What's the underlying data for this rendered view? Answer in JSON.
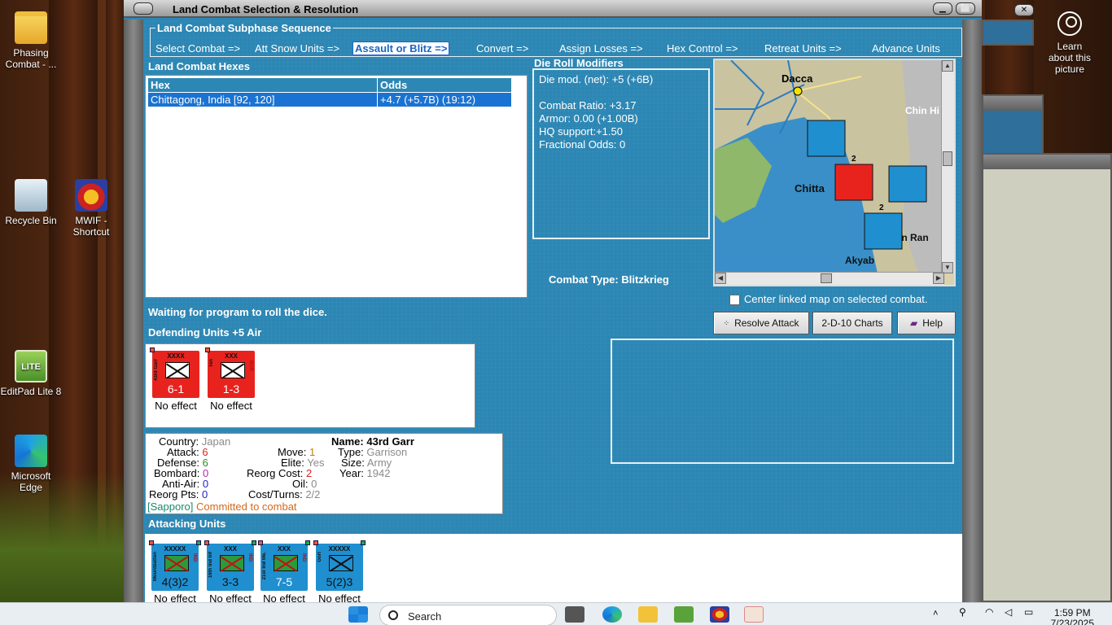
{
  "desktop": {
    "icons": [
      {
        "label": "Phasing Combat - ..."
      },
      {
        "label": "Recycle Bin"
      },
      {
        "label": "MWIF - Shortcut"
      },
      {
        "label": "EditPad Lite 8"
      },
      {
        "label": "Microsoft Edge"
      }
    ],
    "learn": "Learn about this picture",
    "editpad_badge": "LITE"
  },
  "window": {
    "title": "Land Combat Selection & Resolution",
    "min": "▁",
    "max": "⬜",
    "close": "✕"
  },
  "sequence": {
    "title": "Land Combat Subphase Sequence",
    "steps": [
      "Select Combat =>",
      "Att Snow Units =>",
      "Assault or Blitz =>",
      "Convert =>",
      "Assign Losses =>",
      "Hex Control =>",
      "Retreat Units =>",
      "Advance Units"
    ],
    "active_index": 2
  },
  "hexes": {
    "title": "Land Combat Hexes",
    "columns": [
      "Hex",
      "Odds"
    ],
    "rows": [
      {
        "hex": "Chittagong, India [92, 120]",
        "odds": "+4.7 (+5.7B) (19:12)"
      }
    ]
  },
  "modifiers": {
    "title": "Die Roll Modifiers",
    "net": "Die mod. (net): +5 (+6B)",
    "lines": [
      "Combat Ratio: +3.17",
      "Armor: 0.00 (+1.00B)",
      "HQ support:+1.50",
      "Fractional Odds: 0"
    ]
  },
  "map": {
    "labels": [
      "Dacca",
      "Chin Hi",
      "Chitta",
      "kan Ran",
      "Akyab"
    ],
    "stack_counts": [
      "2",
      "2"
    ]
  },
  "combat_type": {
    "label": "Combat Type:",
    "value": "Blitzkrieg"
  },
  "center_linked": "Center linked map on selected combat.",
  "buttons": {
    "resolve": "Resolve Attack",
    "charts": "2-D-10 Charts",
    "help": "Help"
  },
  "status": "Waiting for program to roll the dice.",
  "defending": {
    "title": "Defending Units +5 Air",
    "units": [
      {
        "size": "XXXX",
        "name": "43rd Garr",
        "nat": "",
        "value": "6-1",
        "effect": "No effect"
      },
      {
        "size": "XXX",
        "name": "Ten",
        "nat": "BUR",
        "value": "1-3",
        "effect": "No effect"
      }
    ]
  },
  "unit_info": {
    "country_label": "Country:",
    "country": "Japan",
    "attack_label": "Attack:",
    "attack": "6",
    "defense_label": "Defense:",
    "defense": "6",
    "bombard_label": "Bombard:",
    "bombard": "0",
    "antiair_label": "Anti-Air:",
    "antiair": "0",
    "reorgpts_label": "Reorg Pts:",
    "reorgpts": "0",
    "move_label": "Move:",
    "move": "1",
    "elite_label": "Elite:",
    "elite": "Yes",
    "reorgcost_label": "Reorg Cost:",
    "reorgcost": "2",
    "oil_label": "Oil:",
    "oil": "0",
    "costturns_label": "Cost/Turns:",
    "costturns": "2/2",
    "name_label": "Name:",
    "name": "43rd Garr",
    "type_label": "Type:",
    "type": "Garrison",
    "size_label": "Size:",
    "size": "Army",
    "year_label": "Year:",
    "year": "1942",
    "home": "[Sapporo]",
    "committed": "Committed to combat"
  },
  "attacking": {
    "title": "Attacking Units",
    "units": [
      {
        "size": "XXXXX",
        "name": "Mountbatten",
        "nat": "IND",
        "value": "4(3)2",
        "effect": "No effect"
      },
      {
        "size": "XXX",
        "name": "16th Ind Inf",
        "nat": "IND",
        "value": "3-3",
        "effect": "No effect"
      },
      {
        "size": "XXX",
        "name": "21st Ind Me.",
        "nat": "IND",
        "value": "7-5",
        "effect": "No effect"
      },
      {
        "size": "XXXXX",
        "name": "Gort",
        "nat": "",
        "value": "5(2)3",
        "effect": "No effect"
      }
    ]
  },
  "taskbar": {
    "search_placeholder": "Search",
    "time": "1:59 PM",
    "date": "7/23/2025"
  },
  "colors": {
    "panel": "#2d87b4",
    "selected_row": "#1a73d2",
    "defender": "#e8231e",
    "attacker": "#1f8fd0"
  }
}
